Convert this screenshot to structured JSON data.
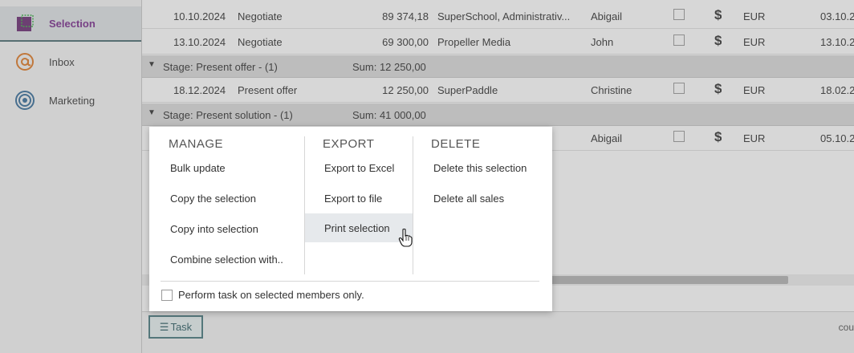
{
  "sidebar": {
    "items": [
      {
        "label": "Selection",
        "icon": "selection-icon"
      },
      {
        "label": "Inbox",
        "icon": "inbox-at-icon"
      },
      {
        "label": "Marketing",
        "icon": "marketing-target-icon"
      }
    ]
  },
  "grid": {
    "rows": [
      {
        "date": "10.10.2024",
        "stage": "Negotiate",
        "amount": "89 374,18",
        "company": "SuperSchool, Administrativ...",
        "person": "Abigail",
        "currency": "EUR",
        "date2": "03.10.2"
      },
      {
        "date": "13.10.2024",
        "stage": "Negotiate",
        "amount": "69 300,00",
        "company": "Propeller Media",
        "person": "John",
        "currency": "EUR",
        "date2": "13.10.2"
      },
      {
        "date": "18.12.2024",
        "stage": "Present offer",
        "amount": "12 250,00",
        "company": "SuperPaddle",
        "person": "Christine",
        "currency": "EUR",
        "date2": "18.02.2"
      },
      {
        "date": "",
        "stage": "",
        "amount": "",
        "company": "",
        "person": "Abigail",
        "currency": "EUR",
        "date2": "05.10.2"
      }
    ],
    "groups": [
      {
        "label": "Stage: Present offer - (1)",
        "sum": "Sum: 12 250,00"
      },
      {
        "label": "Stage: Present solution - (1)",
        "sum": "Sum: 41 000,00"
      }
    ],
    "dollar": "$"
  },
  "menu": {
    "manage": {
      "title": "MANAGE",
      "items": [
        "Bulk update",
        "Copy the selection",
        "Copy into selection",
        "Combine selection with.."
      ]
    },
    "export": {
      "title": "EXPORT",
      "items": [
        "Export to Excel",
        "Export to file",
        "Print selection"
      ]
    },
    "delete": {
      "title": "DELETE",
      "items": [
        "Delete this selection",
        "Delete all sales"
      ]
    },
    "perform_label": "Perform task on selected members only."
  },
  "footer": {
    "task_label": "Task",
    "right_text": "cou"
  },
  "colors": {
    "accent": "#7b2f8e",
    "teal": "#4a7a80",
    "orange": "#e07b28"
  }
}
